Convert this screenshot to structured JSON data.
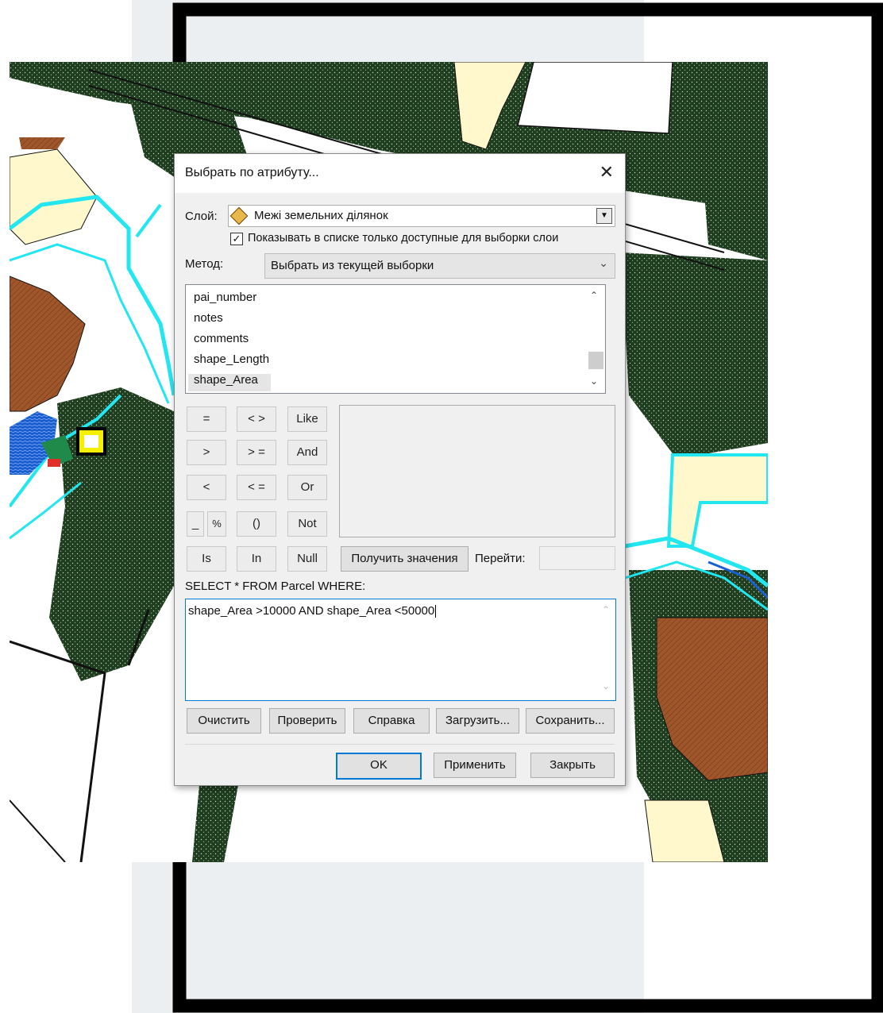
{
  "dialog": {
    "title": "Выбрать по атрибуту...",
    "layer_label": "Слой:",
    "layer_value": "Межі земельних ділянок",
    "only_selectable_checked": true,
    "only_selectable_label": "Показывать в списке только доступные для выборки слои",
    "method_label": "Метод:",
    "method_value": "Выбрать из текущей выборки",
    "fields": [
      "pai_number",
      "notes",
      "comments",
      "shape_Length",
      "shape_Area"
    ],
    "selected_field": "shape_Area",
    "operators": {
      "eq": "=",
      "ne": "< >",
      "like": "Like",
      "gt": ">",
      "ge": "> =",
      "and": "And",
      "lt": "<",
      "le": "< =",
      "or": "Or",
      "underscore": "_",
      "percent": "%",
      "parens": "()",
      "not": "Not",
      "is": "Is",
      "in": "In",
      "null": "Null"
    },
    "get_values_label": "Получить значения",
    "goto_label": "Перейти:",
    "goto_value": "",
    "sql_prefix": "SELECT * FROM Parcel WHERE:",
    "sql_text": "shape_Area >10000 AND shape_Area <50000",
    "buttons": {
      "clear": "Очистить",
      "verify": "Проверить",
      "help": "Справка",
      "load": "Загрузить...",
      "save": "Сохранить...",
      "ok": "OK",
      "apply": "Применить",
      "close": "Закрыть"
    }
  },
  "colors": {
    "forest": "#1f3d1f",
    "meadow": "#fff8cc",
    "parcel_outline": "#22e6f0",
    "arable": "#a0562b",
    "water": "#1a5fd0",
    "accent": "#0078d7"
  },
  "icons": {
    "layer": "layer-diamond-icon",
    "close": "close-x-icon",
    "scroll_up": "chevron-up-icon",
    "scroll_down": "chevron-down-icon",
    "combo_arrow": "dropdown-arrow-icon",
    "map_marker": "house-marker-icon"
  }
}
